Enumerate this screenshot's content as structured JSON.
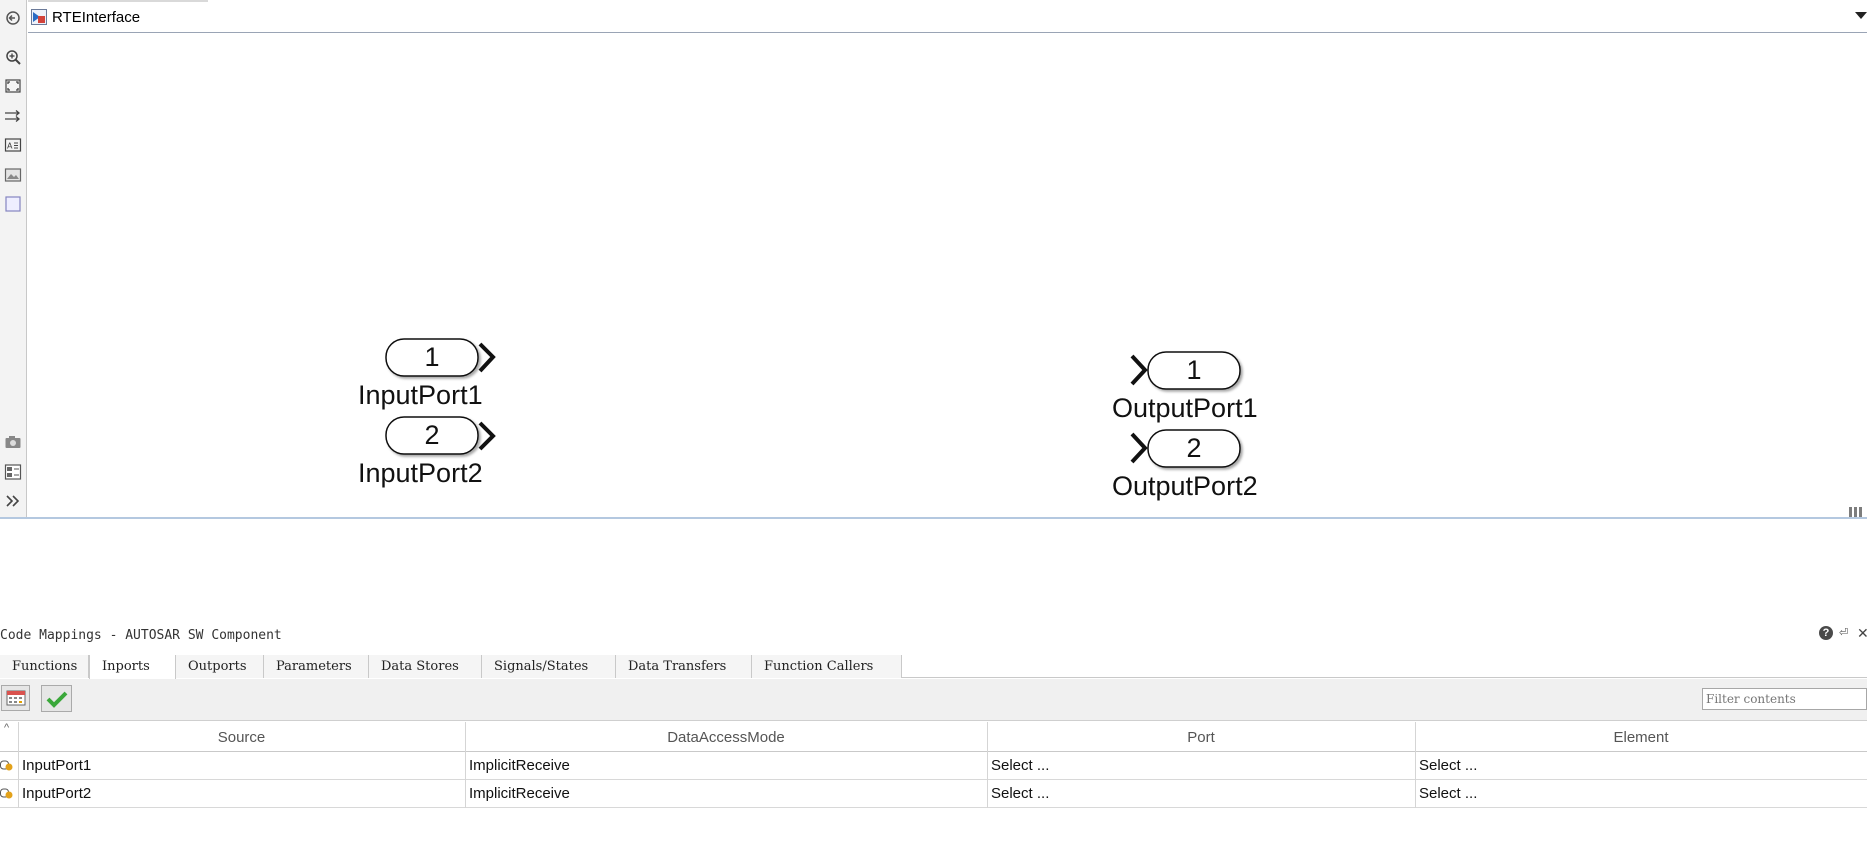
{
  "window": {
    "model_name": "RTEInterface"
  },
  "toolbar_icons": [
    "back-icon",
    "zoom-icon",
    "fit-view-icon",
    "signal-lines-icon",
    "annotation-icon",
    "image-icon",
    "area-icon",
    "screenshot-icon",
    "model-browser-icon",
    "expand-icon"
  ],
  "canvas": {
    "inports": [
      {
        "number": "1",
        "label": "InputPort1"
      },
      {
        "number": "2",
        "label": "InputPort2"
      }
    ],
    "outports": [
      {
        "number": "1",
        "label": "OutputPort1"
      },
      {
        "number": "2",
        "label": "OutputPort2"
      }
    ]
  },
  "code_mappings": {
    "title": "Code Mappings - AUTOSAR SW Component",
    "tabs": [
      "Functions",
      "Inports",
      "Outports",
      "Parameters",
      "Data Stores",
      "Signals/States",
      "Data Transfers",
      "Function Callers"
    ],
    "active_tab": "Inports",
    "filter_placeholder": "Filter contents",
    "columns": [
      "Source",
      "DataAccessMode",
      "Port",
      "Element"
    ],
    "rows": [
      {
        "source": "InputPort1",
        "mode": "ImplicitReceive",
        "port": "Select ...",
        "element": "Select ..."
      },
      {
        "source": "InputPort2",
        "mode": "ImplicitReceive",
        "port": "Select ...",
        "element": "Select ..."
      }
    ]
  },
  "colors": {
    "accent": "#1f5fa8",
    "check": "#3aa83a",
    "divider": "#b4c8e0"
  }
}
